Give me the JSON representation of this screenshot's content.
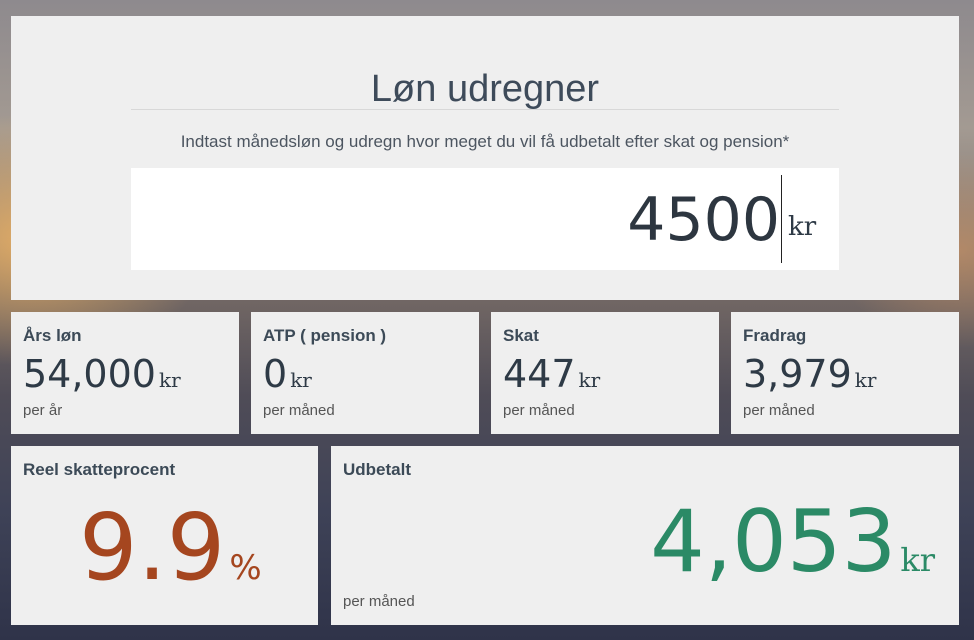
{
  "header": {
    "title": "Løn udregner",
    "subtitle": "Indtast månedsløn og udregn hvor meget du vil få udbetalt efter skat og pension*",
    "salary_value": "4500",
    "salary_unit": "kr"
  },
  "cards": [
    {
      "title": "Års løn",
      "value": "54,000",
      "unit": "kr",
      "sub": "per år"
    },
    {
      "title": "ATP ( pension )",
      "value": "0",
      "unit": "kr",
      "sub": "per måned"
    },
    {
      "title": "Skat",
      "value": "447",
      "unit": "kr",
      "sub": "per måned"
    },
    {
      "title": "Fradrag",
      "value": "3,979",
      "unit": "kr",
      "sub": "per måned"
    }
  ],
  "tax_rate": {
    "title": "Reel skatteprocent",
    "value": "9.9",
    "unit": "%"
  },
  "payout": {
    "title": "Udbetalt",
    "value": "4,053",
    "unit": "kr",
    "sub": "per måned"
  },
  "colors": {
    "tax_rate": "#a5461f",
    "payout": "#2b8a66",
    "card_bg": "#efefef"
  }
}
